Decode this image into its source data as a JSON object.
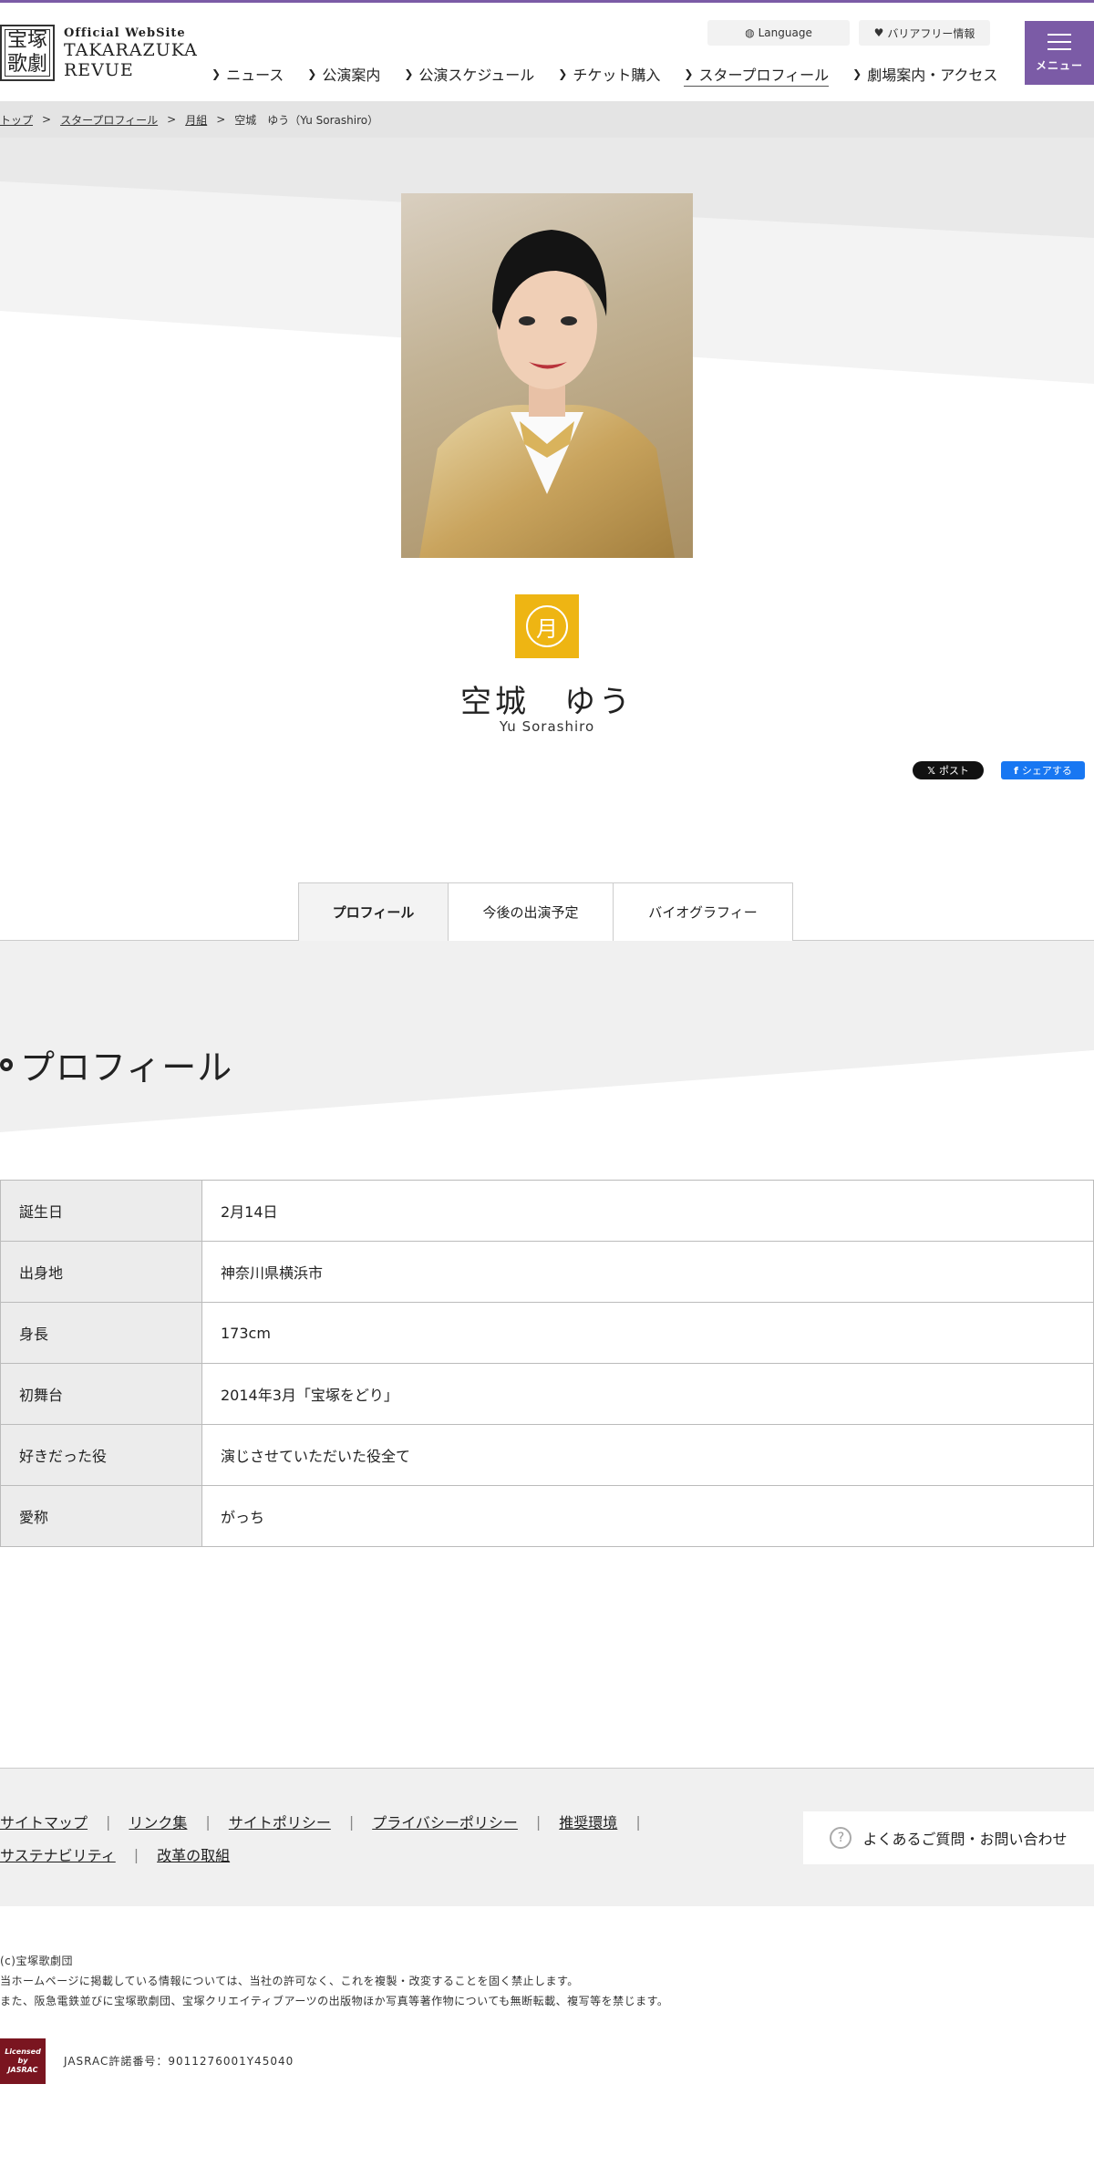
{
  "header": {
    "logo_mark_top": "宝塚",
    "logo_mark_bottom": "歌劇",
    "logo_small": "Official WebSite",
    "logo_line1": "TAKARAZUKA",
    "logo_line2": "REVUE",
    "language": "Language",
    "barrier_free": "バリアフリー情報",
    "menu_label": "メニュー",
    "nav": [
      "ニュース",
      "公演案内",
      "公演スケジュール",
      "チケット購入",
      "スタープロフィール",
      "劇場案内・アクセス"
    ],
    "nav_active_index": 4
  },
  "breadcrumb": [
    "トップ",
    "スタープロフィール",
    "月組",
    "空城　ゆう（Yu Sorashiro）"
  ],
  "star": {
    "emblem_char": "月",
    "name_jp": "空城　ゆう",
    "name_en": "Yu Sorashiro"
  },
  "share": {
    "x_label": "ポスト",
    "fb_label": "シェアする"
  },
  "tabs": [
    "プロフィール",
    "今後の出演予定",
    "バイオグラフィー"
  ],
  "section_title": "プロフィール",
  "profile": [
    {
      "key": "誕生日",
      "value": "2月14日"
    },
    {
      "key": "出身地",
      "value": "神奈川県横浜市"
    },
    {
      "key": "身長",
      "value": "173cm"
    },
    {
      "key": "初舞台",
      "value": "2014年3月「宝塚をどり」"
    },
    {
      "key": "好きだった役",
      "value": "演じさせていただいた役全て"
    },
    {
      "key": "愛称",
      "value": "がっち"
    }
  ],
  "footer": {
    "links_row1": [
      "サイトマップ",
      "リンク集",
      "サイトポリシー",
      "プライバシーポリシー",
      "推奨環境"
    ],
    "links_row2": [
      "サステナビリティ",
      "改革の取組"
    ],
    "faq": "よくあるご質問・お問い合わせ",
    "copyright": "(c)宝塚歌劇団",
    "notice1": "当ホームページに掲載している情報については、当社の許可なく、これを複製・改変することを固く禁止します。",
    "notice2": "また、阪急電鉄並びに宝塚歌劇団、宝塚クリエイティブアーツの出版物ほか写真等著作物についても無断転載、複写等を禁じます。",
    "jasrac_logo_l1": "Licensed",
    "jasrac_logo_l2": "by",
    "jasrac_logo_l3": "JASRAC",
    "jasrac": "JASRAC許諾番号：9011276001Y45040"
  },
  "colors": {
    "accent": "#7b5ba6",
    "emblem": "#eeb513",
    "facebook": "#1877f2"
  }
}
